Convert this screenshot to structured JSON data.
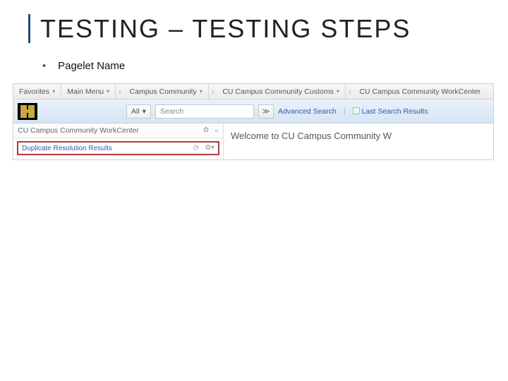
{
  "slide": {
    "title": "TESTING – TESTING STEPS",
    "bullet1": "Pagelet Name"
  },
  "breadcrumb": {
    "favorites": "Favorites",
    "mainmenu": "Main Menu",
    "campus": "Campus Community",
    "customs": "CU Campus Community Customs",
    "workcenter": "CU Campus Community WorkCenter"
  },
  "search": {
    "scope": "All",
    "placeholder": "Search",
    "go_glyph": "≫",
    "advanced": "Advanced Search",
    "last_results": "Last Search Results"
  },
  "left_panel": {
    "header": "CU Campus Community WorkCenter",
    "highlight": "Duplicate Resolution Results"
  },
  "right_panel": {
    "welcome": "Welcome to CU Campus Community W"
  },
  "glyphs": {
    "caret": "▾",
    "chevron": "›",
    "gear": "✿",
    "collapse": "«",
    "refresh": "⟳",
    "gear_caret": "✿▾"
  }
}
